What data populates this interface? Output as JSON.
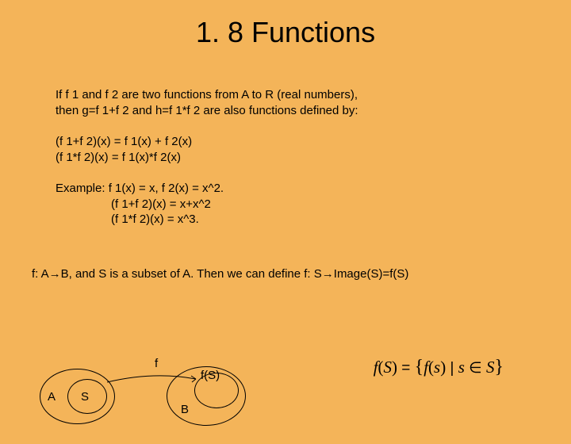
{
  "title": "1. 8 Functions",
  "para1_line1": "If f 1 and f 2 are two functions from A to R (real numbers),",
  "para1_line2": "then g=f 1+f 2 and h=f 1*f 2 are also functions defined by:",
  "def_line1": "(f 1+f 2)(x) = f 1(x) + f 2(x)",
  "def_line2": "(f 1*f 2)(x) = f 1(x)*f 2(x)",
  "example_label": "Example: f 1(x) = x, f 2(x) = x^2.",
  "example_line2": "(f 1+f 2)(x) = x+x^2",
  "example_line3": "(f 1*f 2)(x) = x^3.",
  "image_def": "f: A→B, and S is a subset of A. Then we can define f: S→Image(S)=f(S)",
  "label_a": "A",
  "label_s": "S",
  "label_f": "f",
  "label_b": "B",
  "label_fs": "f(S)",
  "formula_f": "f",
  "formula_S1": "S",
  "formula_f2": "f",
  "formula_s": "s",
  "formula_s2": "s",
  "formula_S2": "S"
}
